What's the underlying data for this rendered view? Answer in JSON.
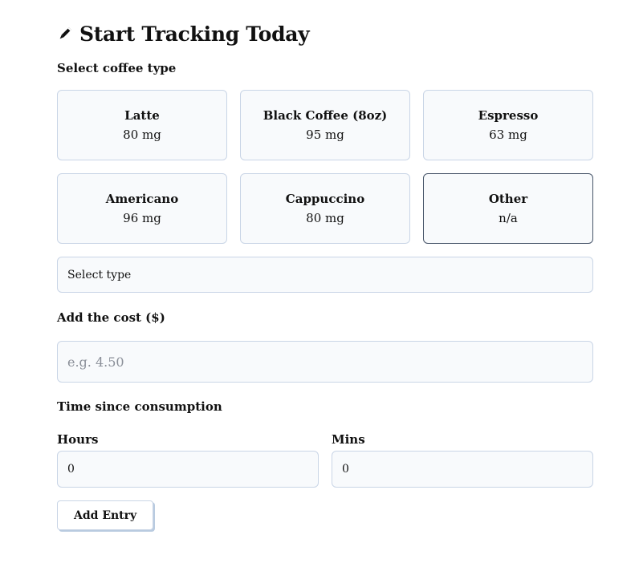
{
  "header": {
    "title": "Start Tracking Today",
    "icon": "pencil-icon"
  },
  "coffee_section": {
    "label": "Select coffee type",
    "options": [
      {
        "name": "Latte",
        "caffeine": "80 mg",
        "selected": false
      },
      {
        "name": "Black Coffee (8oz)",
        "caffeine": "95 mg",
        "selected": false
      },
      {
        "name": "Espresso",
        "caffeine": "63 mg",
        "selected": false
      },
      {
        "name": "Americano",
        "caffeine": "96 mg",
        "selected": false
      },
      {
        "name": "Cappuccino",
        "caffeine": "80 mg",
        "selected": false
      },
      {
        "name": "Other",
        "caffeine": "n/a",
        "selected": true
      }
    ],
    "type_select_value": "Select type"
  },
  "cost_section": {
    "label": "Add the cost ($)",
    "placeholder": "e.g. 4.50",
    "value": ""
  },
  "time_section": {
    "label": "Time since consumption",
    "hours_label": "Hours",
    "hours_value": "0",
    "mins_label": "Mins",
    "mins_value": "0"
  },
  "actions": {
    "add_entry_label": "Add Entry"
  },
  "colors": {
    "border": "#c9d5e6",
    "selected_border": "#475569",
    "field_background": "#f8fafc"
  }
}
